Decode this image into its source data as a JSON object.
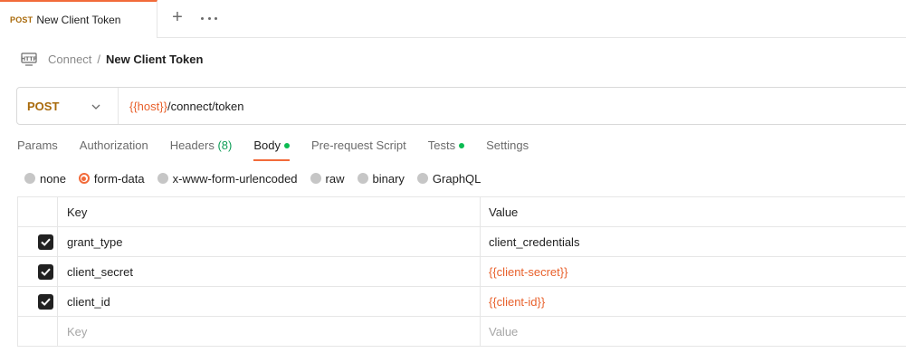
{
  "tab": {
    "method": "POST",
    "title": "New Client Token"
  },
  "tabbar": {
    "add_icon": "plus-icon",
    "more_icon": "more-dots-icon"
  },
  "breadcrumb": {
    "icon": "http-icon",
    "parent": "Connect",
    "separator": "/",
    "current": "New Client Token"
  },
  "request": {
    "method": "POST",
    "url_variable": "{{host}}",
    "url_path": "/connect/token"
  },
  "request_tabs": [
    {
      "label": "Params"
    },
    {
      "label": "Authorization"
    },
    {
      "label": "Headers",
      "count": "(8)"
    },
    {
      "label": "Body",
      "dot": true,
      "active": true
    },
    {
      "label": "Pre-request Script"
    },
    {
      "label": "Tests",
      "dot": true
    },
    {
      "label": "Settings"
    }
  ],
  "body_types": [
    {
      "label": "none",
      "selected": false
    },
    {
      "label": "form-data",
      "selected": true
    },
    {
      "label": "x-www-form-urlencoded",
      "selected": false
    },
    {
      "label": "raw",
      "selected": false
    },
    {
      "label": "binary",
      "selected": false
    },
    {
      "label": "GraphQL",
      "selected": false
    }
  ],
  "table": {
    "headers": {
      "key": "Key",
      "value": "Value"
    },
    "rows": [
      {
        "checked": true,
        "key": "grant_type",
        "value": "client_credentials"
      },
      {
        "checked": true,
        "key": "client_secret",
        "value": "{{client-secret}}"
      },
      {
        "checked": true,
        "key": "client_id",
        "value": "{{client-id}}"
      }
    ],
    "placeholder": {
      "key": "Key",
      "value": "Value"
    }
  },
  "colors": {
    "accent": "#f26b3a",
    "method": "#a96a0b",
    "variable": "#e8612c",
    "dot": "#0cbb52"
  }
}
